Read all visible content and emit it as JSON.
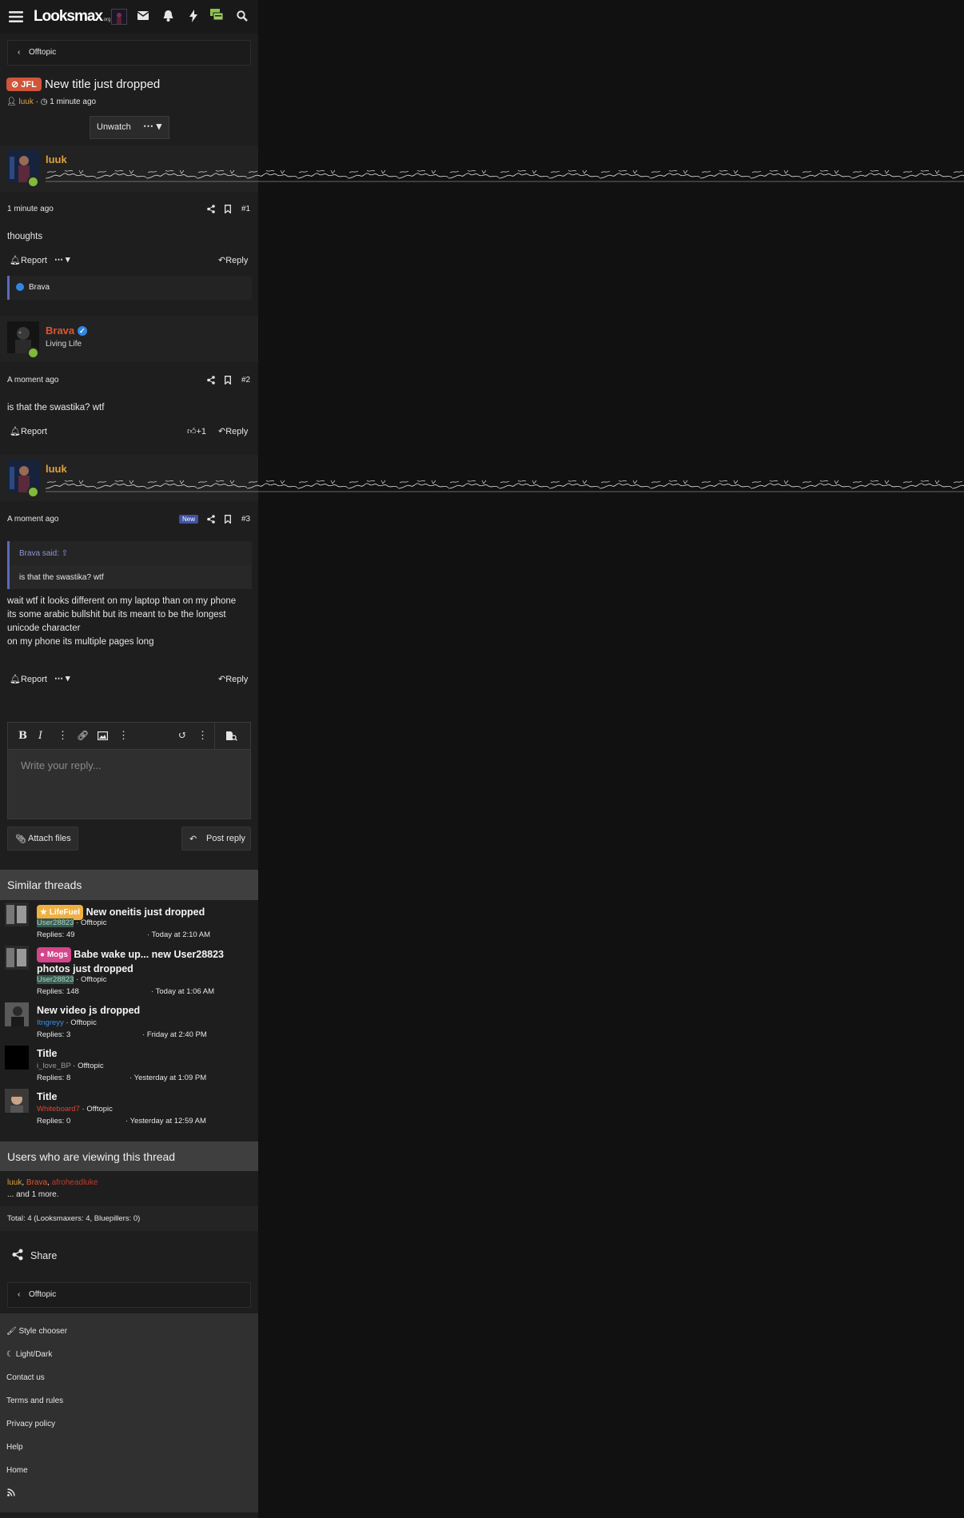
{
  "header": {
    "logo_text": "Looksmax",
    "logo_suffix": ".org",
    "icons": [
      "menu-icon",
      "avatar",
      "mail-icon",
      "bell-icon",
      "bolt-icon",
      "chat-icon",
      "search-icon"
    ]
  },
  "breadcrumb": {
    "label": "Offtopic"
  },
  "thread": {
    "prefix": "JFL",
    "title": "New title just dropped",
    "author": "luuk",
    "time": "1 minute ago",
    "unwatch_label": "Unwatch",
    "more_label": "⋯"
  },
  "posts": [
    {
      "username": "luuk",
      "date": "1 minute ago",
      "number": "#1",
      "body": "thoughts",
      "report_label": "Report",
      "reply_label": "Reply",
      "reaction_user": "Brava"
    },
    {
      "username": "Brava",
      "user_title": "Living Life",
      "date": "A moment ago",
      "number": "#2",
      "body": "is that the swastika? wtf",
      "report_label": "Report",
      "like_count": "+1",
      "reply_label": "Reply"
    },
    {
      "username": "luuk",
      "date": "A moment ago",
      "new_badge": "New",
      "number": "#3",
      "quote_author": "Brava said:",
      "quote_text": "is that the swastika? wtf",
      "body_lines": [
        "wait wtf it looks different on my laptop than on my phone",
        "its some arabic bullshit but its meant to be the longest unicode character",
        "on my phone its multiple pages long"
      ],
      "report_label": "Report",
      "reply_label": "Reply"
    }
  ],
  "editor": {
    "placeholder": "Write your reply...",
    "attach_label": "Attach files",
    "post_label": "Post reply"
  },
  "similar": {
    "heading": "Similar threads",
    "threads": [
      {
        "prefix": "LifeFuel",
        "title": "New oneitis just dropped",
        "user": "User28823",
        "forum": "Offtopic",
        "replies": "Replies: 49",
        "date": "Today at 2:10 AM"
      },
      {
        "prefix": "Mogs",
        "title": "Babe wake up... new User28823 photos just dropped",
        "user": "User28823",
        "forum": "Offtopic",
        "replies": "Replies: 148",
        "date": "Today at 1:06 AM"
      },
      {
        "title": "New video js dropped",
        "user": "Itngreyy",
        "forum": "Offtopic",
        "replies": "Replies: 3",
        "date": "Friday at 2:40 PM"
      },
      {
        "title": "Title",
        "user": "i_love_BP",
        "forum": "Offtopic",
        "replies": "Replies: 8",
        "date": "Yesterday at 1:09 PM"
      },
      {
        "title": "Title",
        "user": "Whiteboard7",
        "forum": "Offtopic",
        "replies": "Replies: 0",
        "date": "Yesterday at 12:59 AM"
      }
    ]
  },
  "viewers": {
    "heading": "Users who are viewing this thread",
    "users": [
      "luuk",
      "Brava",
      "afroheadluke"
    ],
    "more": "... and 1 more.",
    "total": "Total: 4 (Looksmaxers: 4, Bluepillers: 0)"
  },
  "share_label": "Share",
  "footer": {
    "style_chooser": "Style chooser",
    "light_dark": "Light/Dark",
    "links": [
      "Contact us",
      "Terms and rules",
      "Privacy policy",
      "Help",
      "Home"
    ]
  },
  "colors": {
    "username_orange": "#e0a13e",
    "brava_red": "#e1562e",
    "verified_blue": "#2f87e2",
    "online_green": "#7fba3a",
    "quote_border": "#5a6abf",
    "jfl_prefix": "#d0553a",
    "lifefuel_prefix": "#f0b040",
    "mogs_prefix": "#d4458a"
  }
}
